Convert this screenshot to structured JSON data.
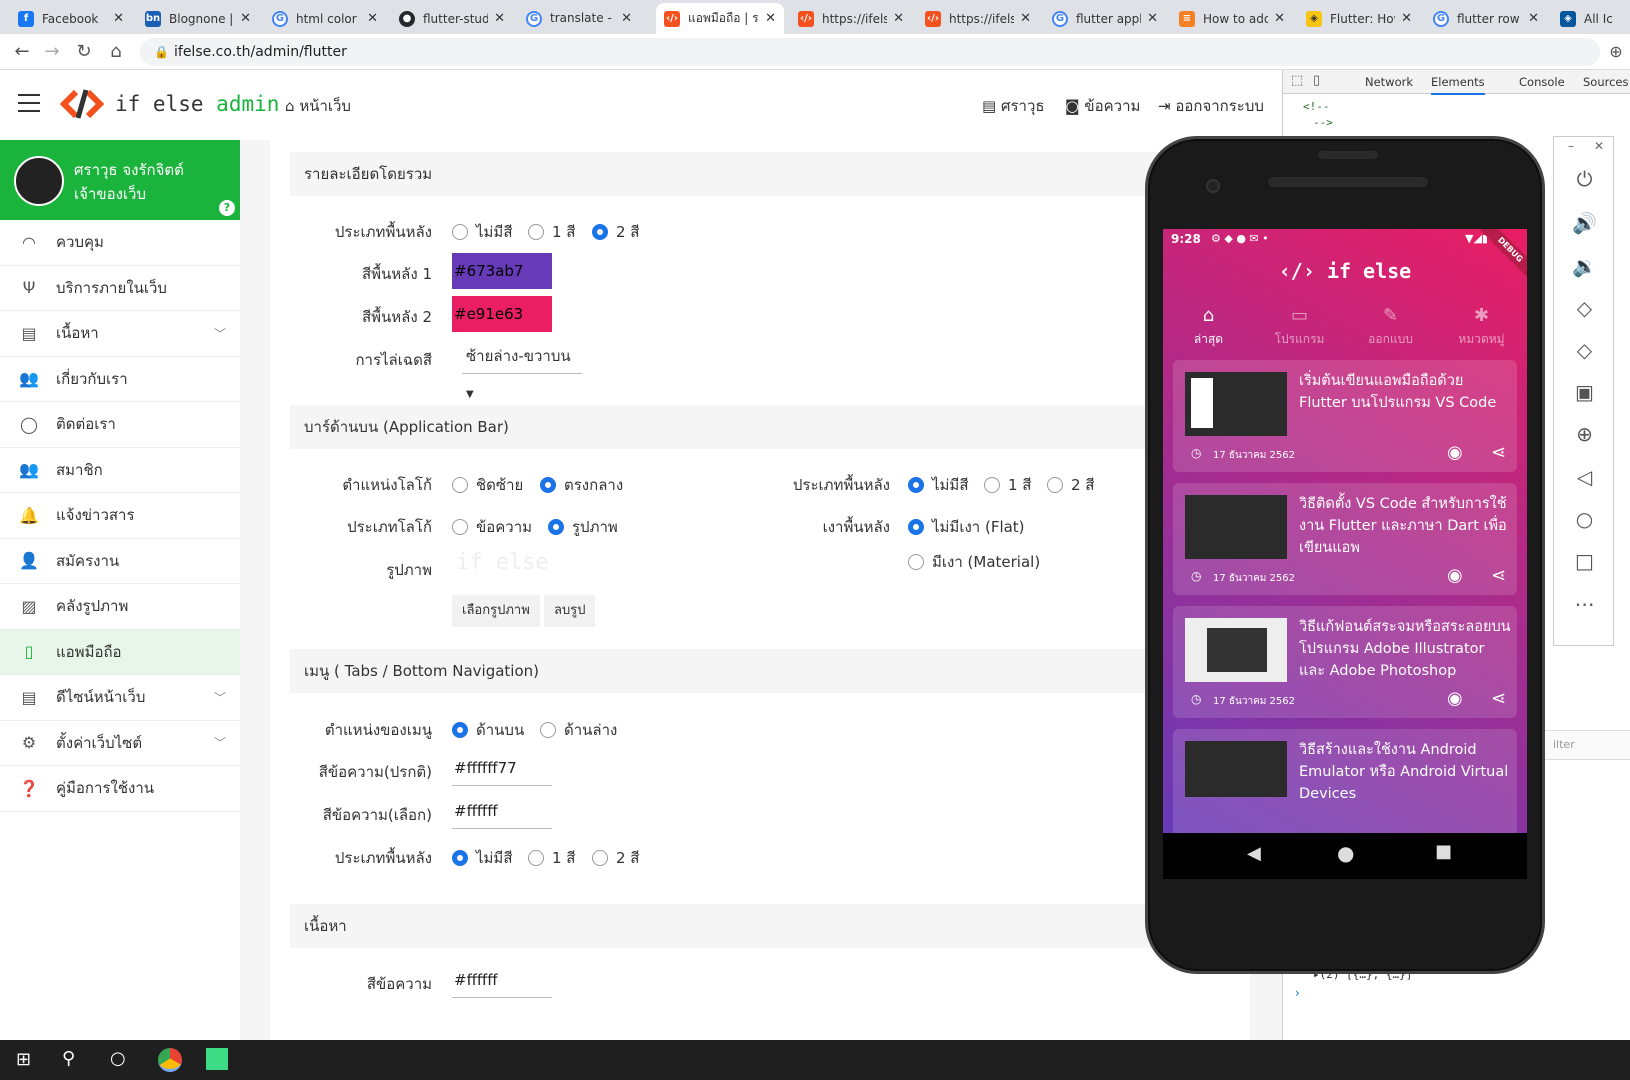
{
  "browser": {
    "tabs": [
      {
        "title": "Facebook",
        "icon": "facebook-icon",
        "color": "#1877f2"
      },
      {
        "title": "Blognone | T",
        "icon": "blognone-icon",
        "color": "#1a5fb4"
      },
      {
        "title": "html color h",
        "icon": "google-icon",
        "color": "#4285f4"
      },
      {
        "title": "flutter-studi",
        "icon": "github-icon",
        "color": "#24292e"
      },
      {
        "title": "translate - ค",
        "icon": "google-icon",
        "color": "#4285f4"
      },
      {
        "title": "แอพมือถือ | ระ",
        "icon": "ifelse-icon",
        "color": "#f4511e"
      },
      {
        "title": "https://ifelse",
        "icon": "ifelse-icon",
        "color": "#f4511e"
      },
      {
        "title": "https://ifelse",
        "icon": "ifelse-icon",
        "color": "#f4511e"
      },
      {
        "title": "flutter appb",
        "icon": "google-icon",
        "color": "#4285f4"
      },
      {
        "title": "How to add",
        "icon": "stackoverflow-icon",
        "color": "#f48024"
      },
      {
        "title": "Flutter: How",
        "icon": "flutter-icon",
        "color": "#f9c513"
      },
      {
        "title": "flutter row h",
        "icon": "google-icon",
        "color": "#4285f4"
      },
      {
        "title": "All Ic",
        "icon": "flutter-icon",
        "color": "#02569b"
      }
    ],
    "url": "ifelse.co.th/admin/flutter"
  },
  "header": {
    "brand": "if else",
    "brand_suffix": "admin",
    "home_label": "หน้าเว็บ",
    "user_label": "ศราวุธ",
    "messages_label": "ข้อความ",
    "logout_label": "ออกจากระบบ"
  },
  "sidebar": {
    "profile_name": "ศราวุธ จงรักจิตต์",
    "profile_role": "เจ้าของเว็บ",
    "items": [
      {
        "label": "ควบคุม",
        "icon": "dashboard-icon"
      },
      {
        "label": "บริการภายในเว็บ",
        "icon": "plug-icon"
      },
      {
        "label": "เนื้อหา",
        "icon": "document-icon"
      },
      {
        "label": "เกี่ยวกับเรา",
        "icon": "group-icon"
      },
      {
        "label": "ติดต่อเรา",
        "icon": "headset-icon"
      },
      {
        "label": "สมาชิก",
        "icon": "users-icon"
      },
      {
        "label": "แจ้งข่าวสาร",
        "icon": "bell-icon"
      },
      {
        "label": "สมัครงาน",
        "icon": "user-tie-icon"
      },
      {
        "label": "คลังรูปภาพ",
        "icon": "image-icon"
      },
      {
        "label": "แอพมือถือ",
        "icon": "mobile-icon"
      },
      {
        "label": "ดีไซน์หน้าเว็บ",
        "icon": "layout-icon"
      },
      {
        "label": "ตั้งค่าเว็บไซต์",
        "icon": "cogs-icon"
      },
      {
        "label": "คู่มือการใช้งาน",
        "icon": "help-icon"
      }
    ]
  },
  "form": {
    "s1_title": "รายละเอียดโดยรวม",
    "bg_type_label": "ประเภทพื้นหลัง",
    "opt_none": "ไม่มีสี",
    "opt_one": "1 สี",
    "opt_two": "2 สี",
    "bg1_label": "สีพื้นหลัง 1",
    "bg1_value": "#673ab7",
    "bg2_label": "สีพื้นหลัง 2",
    "bg2_value": "#e91e63",
    "gradient_label": "การไล่เฉดสี",
    "gradient_value": "ซ้ายล่าง-ขวาบน",
    "s2_title": "บาร์ด้านบน (Application Bar)",
    "logo_pos_label": "ตำแหน่งโลโก้",
    "logo_pos_left": "ชิดซ้าย",
    "logo_pos_center": "ตรงกลาง",
    "logo_type_label": "ประเภทโลโก้",
    "logo_type_text": "ข้อความ",
    "logo_type_image": "รูปภาพ",
    "image_label": "รูปภาพ",
    "image_logo_text": "if else",
    "choose_image": "เลือกรูปภาพ",
    "delete_image": "ลบรูป",
    "appbar_bg_label": "ประเภทพื้นหลัง",
    "shadow_label": "เงาพื้นหลัง",
    "shadow_flat": "ไม่มีเงา (Flat)",
    "shadow_material": "มีเงา (Material)",
    "s3_title": "เมนู ( Tabs / Bottom Navigation)",
    "menu_pos_label": "ตำแหน่งของเมนู",
    "menu_top": "ด้านบน",
    "menu_bottom": "ด้านล่าง",
    "text_normal_label": "สีข้อความ(ปรกติ)",
    "text_normal_value": "#ffffff77",
    "text_selected_label": "สีข้อความ(เลือก)",
    "text_selected_value": "#ffffff",
    "menu_bg_label": "ประเภทพื้นหลัง",
    "s4_title": "เนื้อหา",
    "content_text_label": "สีข้อความ",
    "content_text_value": "#ffffff"
  },
  "devtools": {
    "tabs": [
      "Network",
      "Elements",
      "Console",
      "Sources"
    ],
    "active_tab": "Elements",
    "code1": "<!--",
    "code2": "-->",
    "filter": "ilter",
    "console1": "▸[]",
    "console2": "▸(2) [{…}, {…}]"
  },
  "phone": {
    "time": "9:28",
    "debug": "DEBUG",
    "app_title": "if else",
    "tabs": [
      {
        "label": "ล่าสุด",
        "icon": "home-icon"
      },
      {
        "label": "โปรแกรม",
        "icon": "code-icon"
      },
      {
        "label": "ออกแบบ",
        "icon": "brush-icon"
      },
      {
        "label": "หมวดหมู่",
        "icon": "book-icon"
      }
    ],
    "posts": [
      {
        "title": "เริ่มต้นเขียนแอพมือถือด้วย Flutter บนโปรแกรม VS Code",
        "date": "17 ธันวาคม 2562"
      },
      {
        "title": "วิธีติดตั้ง VS Code สำหรับการใช้งาน Flutter และภาษา Dart เพื่อเขียนแอพ",
        "date": "17 ธันวาคม 2562"
      },
      {
        "title": "วิธีแก้ฟอนต์สระจมหรือสระลอยบนโปรแกรม Adobe Illustrator และ Adobe Photoshop",
        "date": "17 ธันวาคม 2562"
      },
      {
        "title": "วิธีสร้างและใช้งาน Android Emulator หรือ Android Virtual Devices",
        "date": ""
      }
    ]
  },
  "colors": {
    "accent_green": "#1ab33c",
    "radio_blue": "#1a73e8",
    "brand_orange": "#f4511e"
  }
}
